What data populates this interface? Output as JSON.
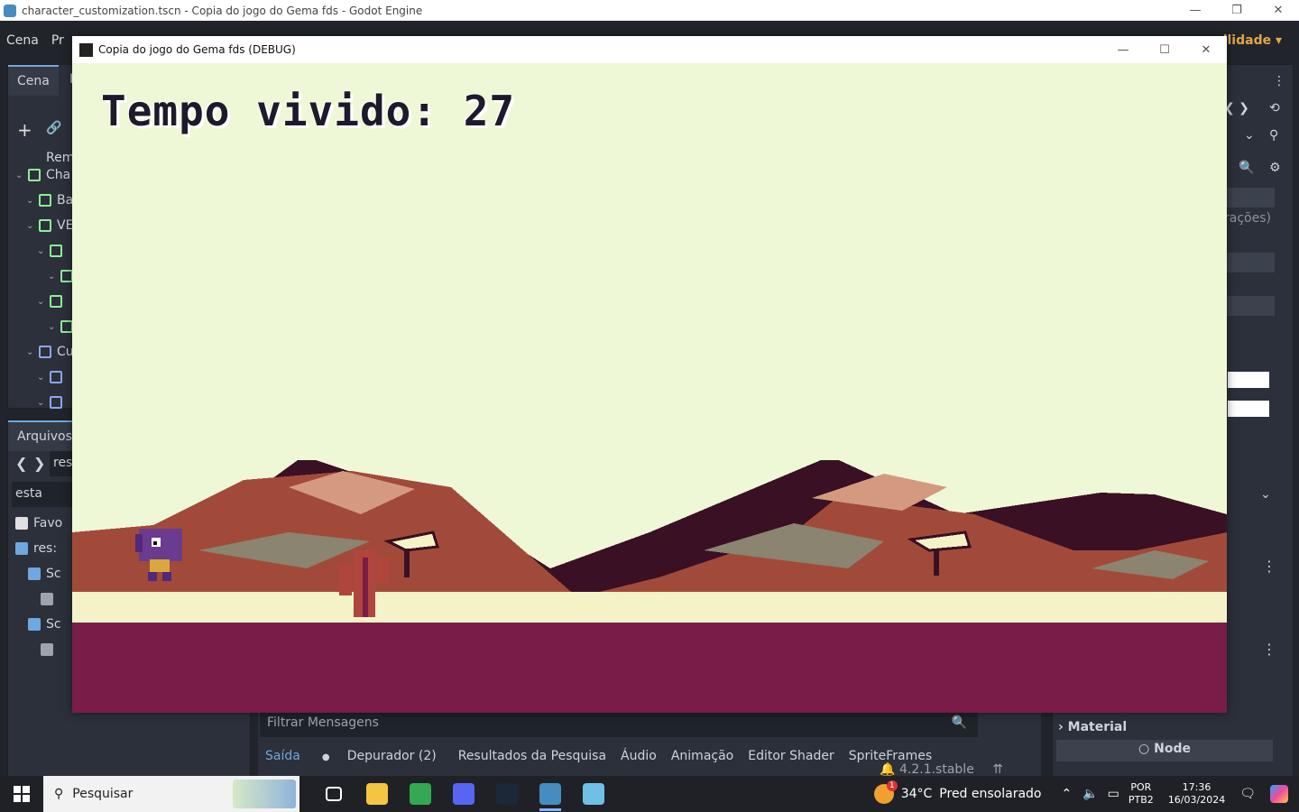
{
  "os_window": {
    "title": "character_customization.tscn - Copia do jogo do Gema fds - Godot Engine"
  },
  "editor": {
    "menu": [
      "Cena",
      "Pr"
    ],
    "menu_right": "ilidade",
    "scene_dock": {
      "tabs": [
        "Cena",
        "I"
      ],
      "remote_label": "Rem",
      "tree": [
        {
          "label": "Cha",
          "icon": "node2d-icon",
          "indent": 0,
          "color": "#8eef97"
        },
        {
          "label": "Ba",
          "icon": "sprite-icon",
          "indent": 1,
          "color": "#8eef97"
        },
        {
          "label": "VE",
          "icon": "vbox-icon",
          "indent": 1,
          "color": "#8eef97"
        },
        {
          "label": "",
          "icon": "label-icon",
          "indent": 2,
          "color": "#8eef97"
        },
        {
          "label": "",
          "icon": "import-icon",
          "indent": 3,
          "color": "#8eef97"
        },
        {
          "label": "",
          "icon": "label-icon",
          "indent": 2,
          "color": "#8eef97"
        },
        {
          "label": "",
          "icon": "import-icon",
          "indent": 3,
          "color": "#8eef97"
        },
        {
          "label": "Cu",
          "icon": "control-icon",
          "indent": 1,
          "color": "#8da5f3"
        },
        {
          "label": "",
          "icon": "panel-icon",
          "indent": 2,
          "color": "#8da5f3"
        },
        {
          "label": "",
          "icon": "godot-icon",
          "indent": 2,
          "color": "#8da5f3"
        }
      ]
    },
    "files_dock": {
      "title": "Arquivos",
      "path": "res:",
      "filter": "esta",
      "tree": [
        {
          "label": "Favo",
          "icon": "star-icon",
          "indent": 0
        },
        {
          "label": "res:",
          "icon": "folder-icon",
          "indent": 0
        },
        {
          "label": "Sc",
          "icon": "folder-icon",
          "indent": 1
        },
        {
          "label": "",
          "icon": "scene-icon",
          "indent": 2
        },
        {
          "label": "Sc",
          "icon": "folder-icon",
          "indent": 1
        },
        {
          "label": "",
          "icon": "gear-icon",
          "indent": 2
        }
      ]
    },
    "inspector": {
      "partial_text": "rações)",
      "material_label": "Material",
      "node_label": "Node"
    },
    "bottom_panel": {
      "filter_placeholder": "Filtrar Mensagens",
      "tabs": [
        {
          "label": "Saída",
          "state": "active"
        },
        {
          "label": "Depurador (2)",
          "state": "warn"
        },
        {
          "label": "Resultados da Pesquisa",
          "state": ""
        },
        {
          "label": "Áudio",
          "state": ""
        },
        {
          "label": "Animação",
          "state": ""
        },
        {
          "label": "Editor Shader",
          "state": ""
        },
        {
          "label": "SpriteFrames",
          "state": ""
        }
      ],
      "version": "4.2.1.stable"
    }
  },
  "game_window": {
    "title": "Copia do jogo do Gema fds (DEBUG)",
    "score_text": "Tempo vivido: 27",
    "colors": {
      "sky": "#eff8d6",
      "ground": "#7a1c48",
      "mountain_dark": "#3a1024",
      "mountain_mid": "#a24a3a",
      "mountain_light": "#d49a80",
      "rock_grey": "#8a8470",
      "sand": "#f4f3c8"
    }
  },
  "taskbar": {
    "search_placeholder": "Pesquisar",
    "apps": [
      {
        "name": "task-view-icon",
        "color": "#ffffff",
        "running": false
      },
      {
        "name": "file-explorer-icon",
        "color": "#f4c542",
        "running": false
      },
      {
        "name": "chrome-icon",
        "color": "#34a853",
        "running": false
      },
      {
        "name": "discord-icon",
        "color": "#5865f2",
        "running": false
      },
      {
        "name": "steam-icon",
        "color": "#1b2838",
        "running": false
      },
      {
        "name": "godot-icon",
        "color": "#478cbf",
        "running": true
      },
      {
        "name": "notepad-icon",
        "color": "#6ec1e4",
        "running": false
      }
    ],
    "weather_temp": "34°C",
    "weather_desc": "Pred ensolarado",
    "weather_badge": "1",
    "lang_top": "POR",
    "lang_bottom": "PTB2",
    "time": "17:36",
    "date": "16/03/2024"
  }
}
